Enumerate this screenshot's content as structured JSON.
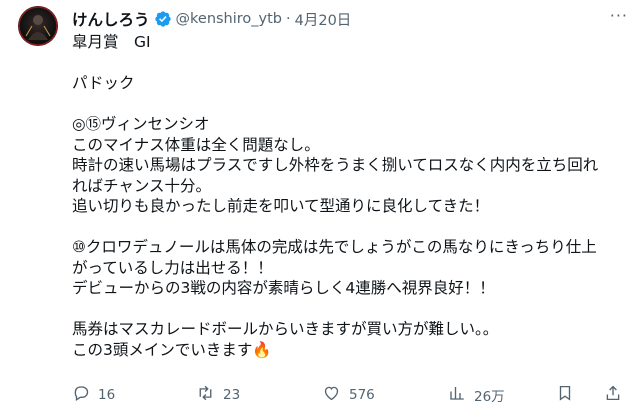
{
  "post": {
    "author_name": "けんしろう",
    "handle": "@kenshiro_ytb",
    "separator": "·",
    "date": "4月20日",
    "more": "···",
    "lines": [
      "皐月賞　GI",
      "",
      "パドック",
      "",
      "◎⑮ヴィンセンシオ",
      "このマイナス体重は全く問題なし。",
      "時計の速い馬場はプラスですし外枠をうまく捌いてロスなく内内を立ち回れ",
      "ればチャンス十分。",
      "追い切りも良かったし前走を叩いて型通りに良化してきた！",
      "",
      "⑩クロワデュノールは馬体の完成は先でしょうがこの馬なりにきっちり仕上",
      "がっているし力は出せる！！",
      "デビューからの3戦の内容が素晴らしく4連勝へ視界良好！！",
      "",
      "馬券はマスカレードボールからいきますが買い方が難しい。。",
      "この3頭メインでいきます🔥"
    ]
  },
  "actions": {
    "replies": "16",
    "reposts": "23",
    "likes": "576",
    "views": "26万"
  },
  "colors": {
    "verified": "#1d9bf0",
    "muted": "#536471",
    "text": "#0f1419"
  },
  "icons": [
    "verified-badge-icon",
    "more-icon",
    "reply-icon",
    "repost-icon",
    "like-icon",
    "views-icon",
    "bookmark-icon",
    "share-icon"
  ]
}
